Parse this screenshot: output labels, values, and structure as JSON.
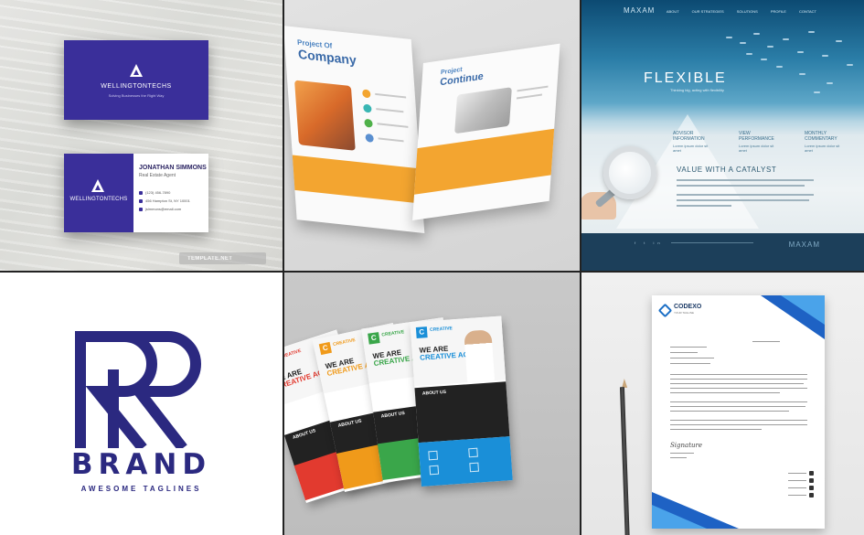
{
  "business_card": {
    "brand": "WELLINGTONTECHS",
    "tagline": "Solving Businesses the Right Way",
    "person_name": "JONATHAN SIMMONS",
    "person_role": "Real Estate Agent",
    "phone": "(123) 456-7890",
    "address": "456 Hampton St, NY 10001",
    "email": "jsimmons@email.com",
    "watermark": "TEMPLATE.NET",
    "color": "#3a2f9a"
  },
  "brochure": {
    "title_left_1": "Project Of",
    "title_left_2": "Company",
    "title_right_1": "Project",
    "title_right_2": "Continue",
    "accent": "#f3a530"
  },
  "website": {
    "logo": "MAXAM",
    "menu": [
      "ABOUT",
      "OUR STRATEGIES",
      "SOLUTIONS",
      "PROFILE",
      "CONTACT"
    ],
    "hero": "FLEXIBLE",
    "hero_sub": "Thinking big, acting with flexibility",
    "columns": [
      {
        "title": "ADVISOR INFORMATION",
        "text": "Lorem ipsum dolor sit amet"
      },
      {
        "title": "VIEW PERFORMANCE",
        "text": "Lorem ipsum dolor sit amet"
      },
      {
        "title": "MONTHLY COMMENTARY",
        "text": "Lorem ipsum dolor sit amet"
      }
    ],
    "heading": "VALUE WITH A CATALYST",
    "footer_logo": "MAXAM",
    "footer_icons": "f  t  in"
  },
  "logo": {
    "wordmark": "BRAND",
    "tagline": "AWESOME TAGLINES",
    "color": "#2b2980"
  },
  "flyers": {
    "badge": "C",
    "label": "CREATIVE",
    "headline_1": "WE ARE",
    "headline_2": "CREATIVE AGENCY",
    "about": "ABOUT US",
    "colors": [
      "#e23a2f",
      "#f09a1a",
      "#3aa64a",
      "#1a8fd8"
    ]
  },
  "letterhead": {
    "company": "CODEXO",
    "tagline": "YOUR TAGLINE",
    "signature": "Signature",
    "accent": "#1e62c4"
  }
}
